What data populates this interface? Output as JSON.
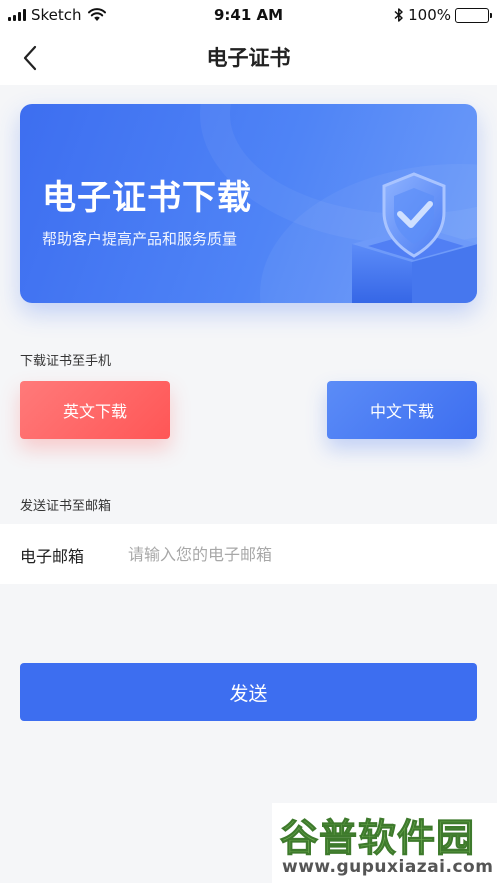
{
  "status_bar": {
    "carrier": "Sketch",
    "time": "9:41 AM",
    "battery": "100%"
  },
  "nav": {
    "title": "电子证书"
  },
  "banner": {
    "heading": "电子证书下载",
    "subtitle": "帮助客户提高产品和服务质量"
  },
  "download_section": {
    "label": "下载证书至手机",
    "english_button": "英文下载",
    "chinese_button": "中文下载"
  },
  "email_section": {
    "label": "发送证书至邮箱",
    "field_label": "电子邮箱",
    "placeholder": "请输入您的电子邮箱",
    "value": ""
  },
  "send_button": "发送",
  "watermark": {
    "title": "谷普软件园",
    "url": "www.gupuxiazai.com"
  },
  "colors": {
    "accent_blue": "#3d6ef0",
    "accent_red": "#ff5e5e",
    "background": "#f5f6f8"
  },
  "icons": [
    "back-chevron-icon",
    "signal-icon",
    "wifi-icon",
    "bluetooth-icon",
    "battery-icon",
    "shield-check-icon"
  ]
}
